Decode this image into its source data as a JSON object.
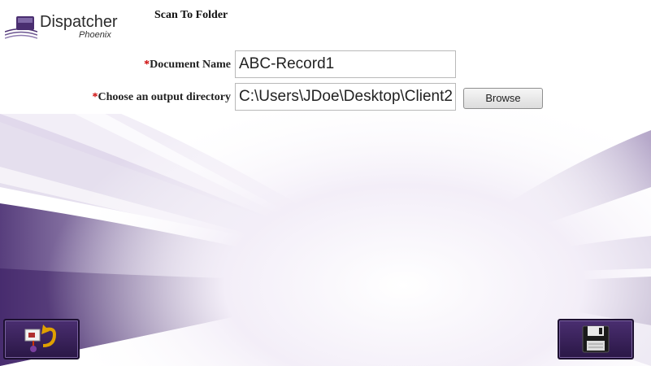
{
  "logo": {
    "name": "Dispatcher",
    "sub": "Phoenix"
  },
  "page": {
    "title": "Scan To Folder"
  },
  "form": {
    "required_marker": "*",
    "document_name": {
      "label": "Document Name",
      "value": "ABC-Record1"
    },
    "output_directory": {
      "label": "Choose an output directory",
      "value": "C:\\Users\\JDoe\\Desktop\\Client2"
    },
    "browse_label": "Browse"
  },
  "colors": {
    "accent": "#4a2e70",
    "required": "#cc0000"
  },
  "icons": {
    "back": "workflow-back-icon",
    "save": "floppy-disk-icon"
  }
}
